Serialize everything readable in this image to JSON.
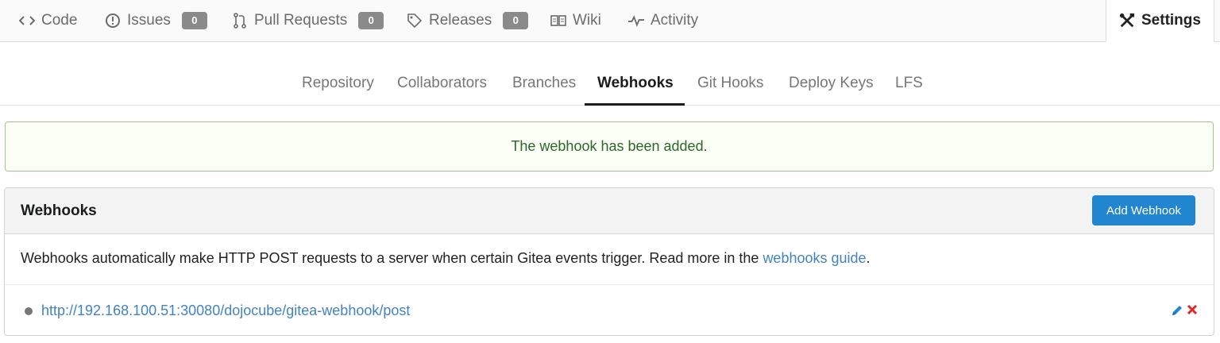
{
  "repo_tabs": {
    "code": {
      "label": "Code"
    },
    "issues": {
      "label": "Issues",
      "count": "0"
    },
    "pulls": {
      "label": "Pull Requests",
      "count": "0"
    },
    "releases": {
      "label": "Releases",
      "count": "0"
    },
    "wiki": {
      "label": "Wiki"
    },
    "activity": {
      "label": "Activity"
    },
    "settings": {
      "label": "Settings"
    }
  },
  "settings_nav": {
    "items": [
      "Repository",
      "Collaborators",
      "Branches",
      "Webhooks",
      "Git Hooks",
      "Deploy Keys",
      "LFS"
    ],
    "active": "Webhooks"
  },
  "flash": {
    "message": "The webhook has been added."
  },
  "webhooks": {
    "title": "Webhooks",
    "add_button": "Add Webhook",
    "description_prefix": "Webhooks automatically make HTTP POST requests to a server when certain Gitea events trigger. Read more in the ",
    "guide_link": "webhooks guide",
    "description_suffix": ".",
    "items": [
      {
        "url": "http://192.168.100.51:30080/dojocube/gitea-webhook/post",
        "status_color": "#777777"
      }
    ]
  },
  "colors": {
    "primary": "#2185d0",
    "link": "#4183c4",
    "success_text": "#2c662d",
    "success_bg": "#fcfff5",
    "delete": "#db2828"
  }
}
